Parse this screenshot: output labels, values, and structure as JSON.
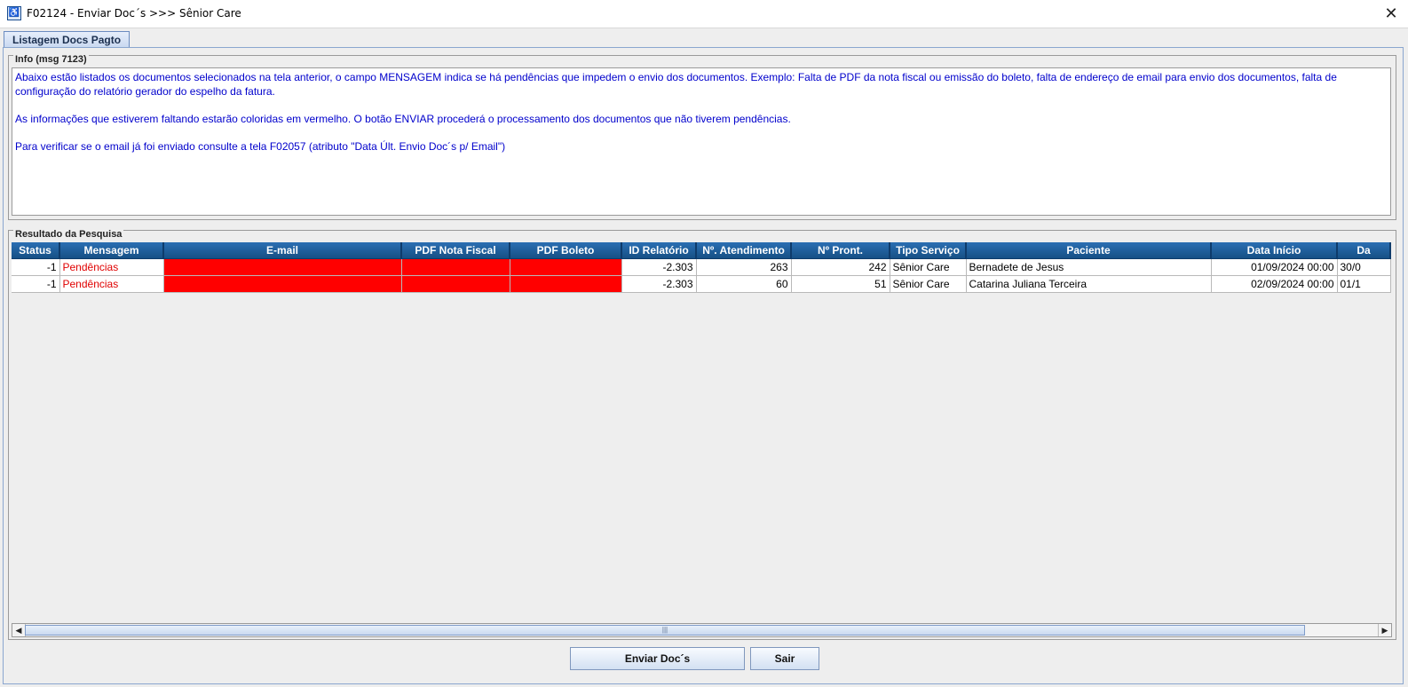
{
  "window": {
    "title": "F02124 - Enviar Doc´s >>> Sênior Care",
    "icon": "app-logo-icon",
    "close_glyph": "✕"
  },
  "tabs": [
    {
      "label": "Listagem Docs Pagto",
      "selected": true
    }
  ],
  "info": {
    "group_title": "Info (msg 7123)",
    "paragraphs": [
      "Abaixo estão listados os documentos selecionados na tela anterior,   o campo MENSAGEM indica se há pendências que impedem o envio dos documentos. Exemplo: Falta de PDF da nota fiscal ou emissão do boleto, falta de endereço de email para envio dos documentos, falta de configuração do relatório gerador do espelho da fatura.",
      "As informações que estiverem faltando estarão coloridas em vermelho.   O botão ENVIAR procederá o processamento dos documentos que não tiverem pendências.",
      "Para verificar se o email já foi enviado consulte a tela F02057 (atributo \"Data Últ. Envio Doc´s p/ Email\")"
    ],
    "text_color": "#0000cc"
  },
  "results": {
    "group_title": "Resultado da Pesquisa",
    "columns": [
      "Status",
      "Mensagem",
      "E-mail",
      "PDF Nota Fiscal",
      "PDF Boleto",
      "ID Relatório",
      "Nº. Atendimento",
      "Nº Pront.",
      "Tipo Serviço",
      "Paciente",
      "Data Início",
      "Da"
    ],
    "rows": [
      {
        "status": "-1",
        "mensagem": "Pendências",
        "email": "",
        "pdf_nota_fiscal": "",
        "pdf_boleto": "",
        "id_relatorio": "-2.303",
        "atendimento": "263",
        "pront": "242",
        "tipo_servico": "Sênior Care",
        "paciente": "Bernadete de Jesus",
        "data_inicio": "01/09/2024 00:00",
        "data_fim": "30/0"
      },
      {
        "status": "-1",
        "mensagem": "Pendências",
        "email": "",
        "pdf_nota_fiscal": "",
        "pdf_boleto": "",
        "id_relatorio": "-2.303",
        "atendimento": "60",
        "pront": "51",
        "tipo_servico": "Sênior Care",
        "paciente": "Catarina Juliana Terceira",
        "data_inicio": "02/09/2024 00:00",
        "data_fim": "01/1"
      }
    ],
    "colors": {
      "header_bg": "#1f5f9e",
      "missing_cell": "#ff0000",
      "pending_text": "#e00000"
    }
  },
  "scrollbar": {
    "left_glyph": "◀",
    "right_glyph": "▶",
    "thumb_glyph": "|||"
  },
  "buttons": {
    "send": "Enviar Doc´s",
    "exit": "Sair"
  }
}
